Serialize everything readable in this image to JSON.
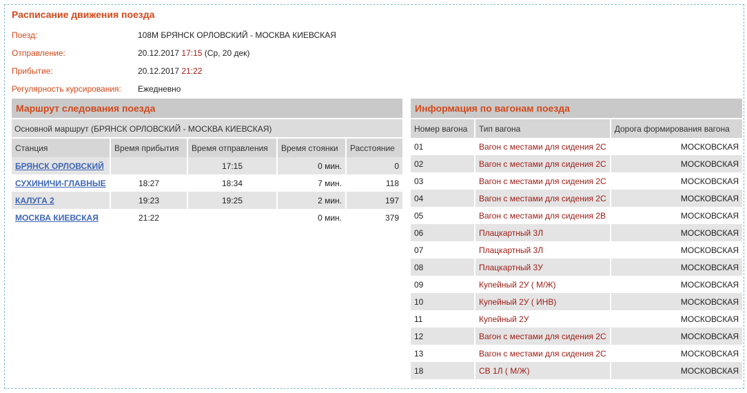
{
  "page": {
    "title": "Расписание движения поезда"
  },
  "info": {
    "train_label": "Поезд:",
    "train_value": "108М БРЯНСК ОРЛОВСКИЙ - МОСКВА КИЕВСКАЯ",
    "departure_label": "Отправление:",
    "departure_date": "20.12.2017",
    "departure_time": "17:15",
    "departure_note": "(Ср, 20 дек)",
    "arrival_label": "Прибытие:",
    "arrival_date": "20.12.2017",
    "arrival_time": "21:22",
    "regularity_label": "Регулярность курсирования:",
    "regularity_value": "Ежедневно"
  },
  "route": {
    "header": "Маршрут следования поезда",
    "subheader": "Основной маршрут (БРЯНСК ОРЛОВСКИЙ - МОСКВА КИЕВСКАЯ)",
    "columns": [
      "Станция",
      "Время прибытия",
      "Время отправления",
      "Время стоянки",
      "Расстояние"
    ],
    "rows": [
      {
        "station": "БРЯНСК ОРЛОВСКИЙ",
        "arrival": "",
        "departure": "17:15",
        "stop": "0 мин.",
        "distance": "0"
      },
      {
        "station": "СУХИНИЧИ-ГЛАВНЫЕ",
        "arrival": "18:27",
        "departure": "18:34",
        "stop": "7 мин.",
        "distance": "118"
      },
      {
        "station": "КАЛУГА 2",
        "arrival": "19:23",
        "departure": "19:25",
        "stop": "2 мин.",
        "distance": "197"
      },
      {
        "station": "МОСКВА КИЕВСКАЯ",
        "arrival": "21:22",
        "departure": "",
        "stop": "0 мин.",
        "distance": "379"
      }
    ]
  },
  "wagons": {
    "header": "Информация по вагонам поезда",
    "columns": [
      "Номер вагона",
      "Тип вагона",
      "Дорога формирования вагона"
    ],
    "rows": [
      {
        "num": "01",
        "type": "Вагон с местами для сидения 2С",
        "road": "МОСКОВСКАЯ"
      },
      {
        "num": "02",
        "type": "Вагон с местами для сидения 2С",
        "road": "МОСКОВСКАЯ"
      },
      {
        "num": "03",
        "type": "Вагон с местами для сидения 2С",
        "road": "МОСКОВСКАЯ"
      },
      {
        "num": "04",
        "type": "Вагон с местами для сидения 2С",
        "road": "МОСКОВСКАЯ"
      },
      {
        "num": "05",
        "type": "Вагон с местами для сидения 2В",
        "road": "МОСКОВСКАЯ"
      },
      {
        "num": "06",
        "type": "Плацкартный 3Л",
        "road": "МОСКОВСКАЯ"
      },
      {
        "num": "07",
        "type": "Плацкартный 3Л",
        "road": "МОСКОВСКАЯ"
      },
      {
        "num": "08",
        "type": "Плацкартный 3У",
        "road": "МОСКОВСКАЯ"
      },
      {
        "num": "09",
        "type": "Купейный 2У ( М/Ж)",
        "road": "МОСКОВСКАЯ"
      },
      {
        "num": "10",
        "type": "Купейный 2У ( ИНВ)",
        "road": "МОСКОВСКАЯ"
      },
      {
        "num": "11",
        "type": "Купейный 2У",
        "road": "МОСКОВСКАЯ"
      },
      {
        "num": "12",
        "type": "Вагон с местами для сидения 2С",
        "road": "МОСКОВСКАЯ"
      },
      {
        "num": "13",
        "type": "Вагон с местами для сидения 2С",
        "road": "МОСКОВСКАЯ"
      },
      {
        "num": "18",
        "type": "СВ 1Л ( М/Ж)",
        "road": "МОСКОВСКАЯ"
      }
    ]
  }
}
